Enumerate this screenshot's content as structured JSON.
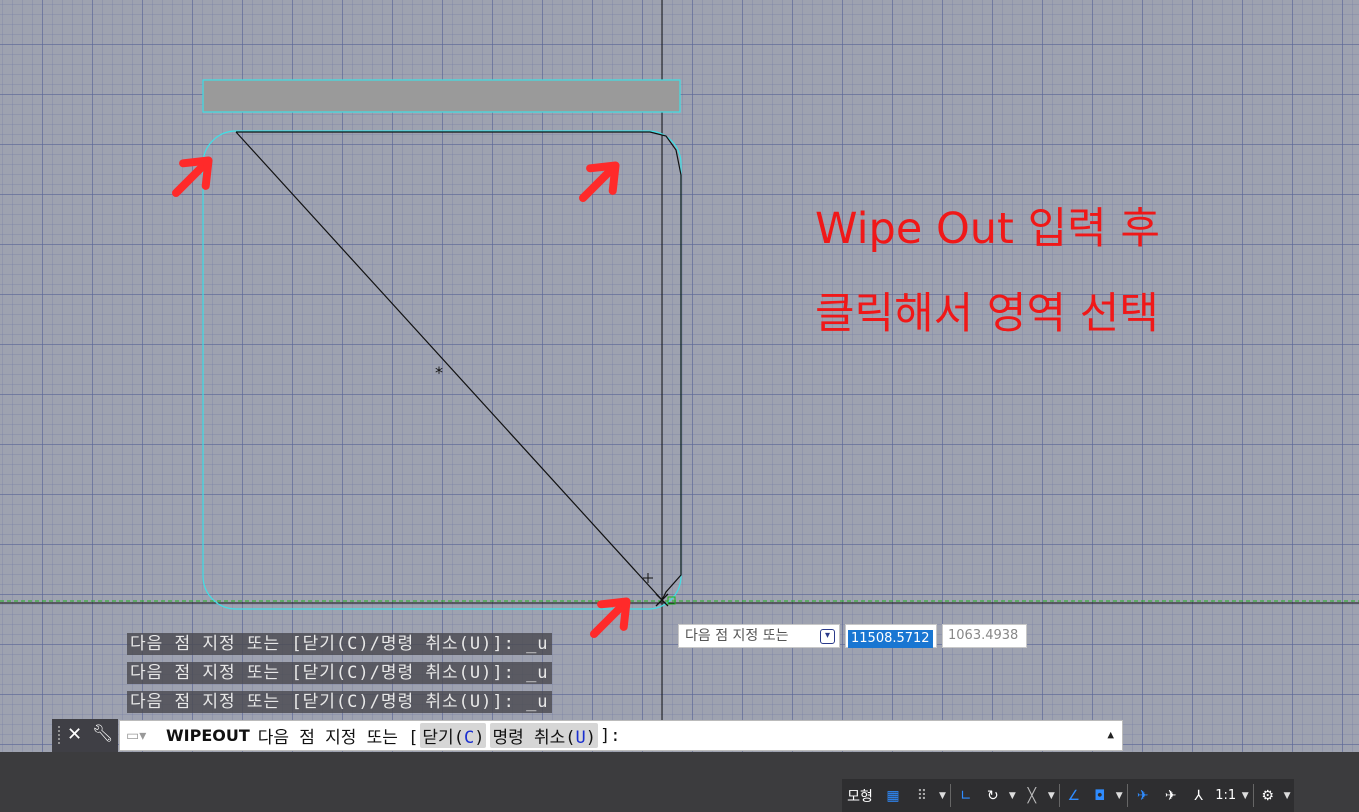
{
  "annotation": {
    "line1": "Wipe Out 입력 후",
    "line2": "클릭해서 영역 선택"
  },
  "history": [
    "다음 점 지정 또는 [닫기(C)/명령 취소(U)]: _u",
    "다음 점 지정 또는 [닫기(C)/명령 취소(U)]: _u",
    "다음 점 지정 또는 [닫기(C)/명령 취소(U)]: _u"
  ],
  "dynamic_input": {
    "prompt": "다음 점 지정 또는",
    "x_value": "11508.5712",
    "y_value": "1063.4938"
  },
  "command_line": {
    "command": "WIPEOUT",
    "prompt": "다음 점 지정 또는 [",
    "option1_text": "닫기(",
    "option1_key": "C",
    "option2_text": "명령 취소(",
    "option2_key": "U",
    "suffix": "]:"
  },
  "status_bar": {
    "model_tab": "모형",
    "scale": "1:1"
  },
  "colors": {
    "canvas": "#9ea2b0",
    "cyan_outline": "#3ee0e6",
    "annotation_red": "#f01818",
    "arrow_red": "#ff2a2a"
  }
}
